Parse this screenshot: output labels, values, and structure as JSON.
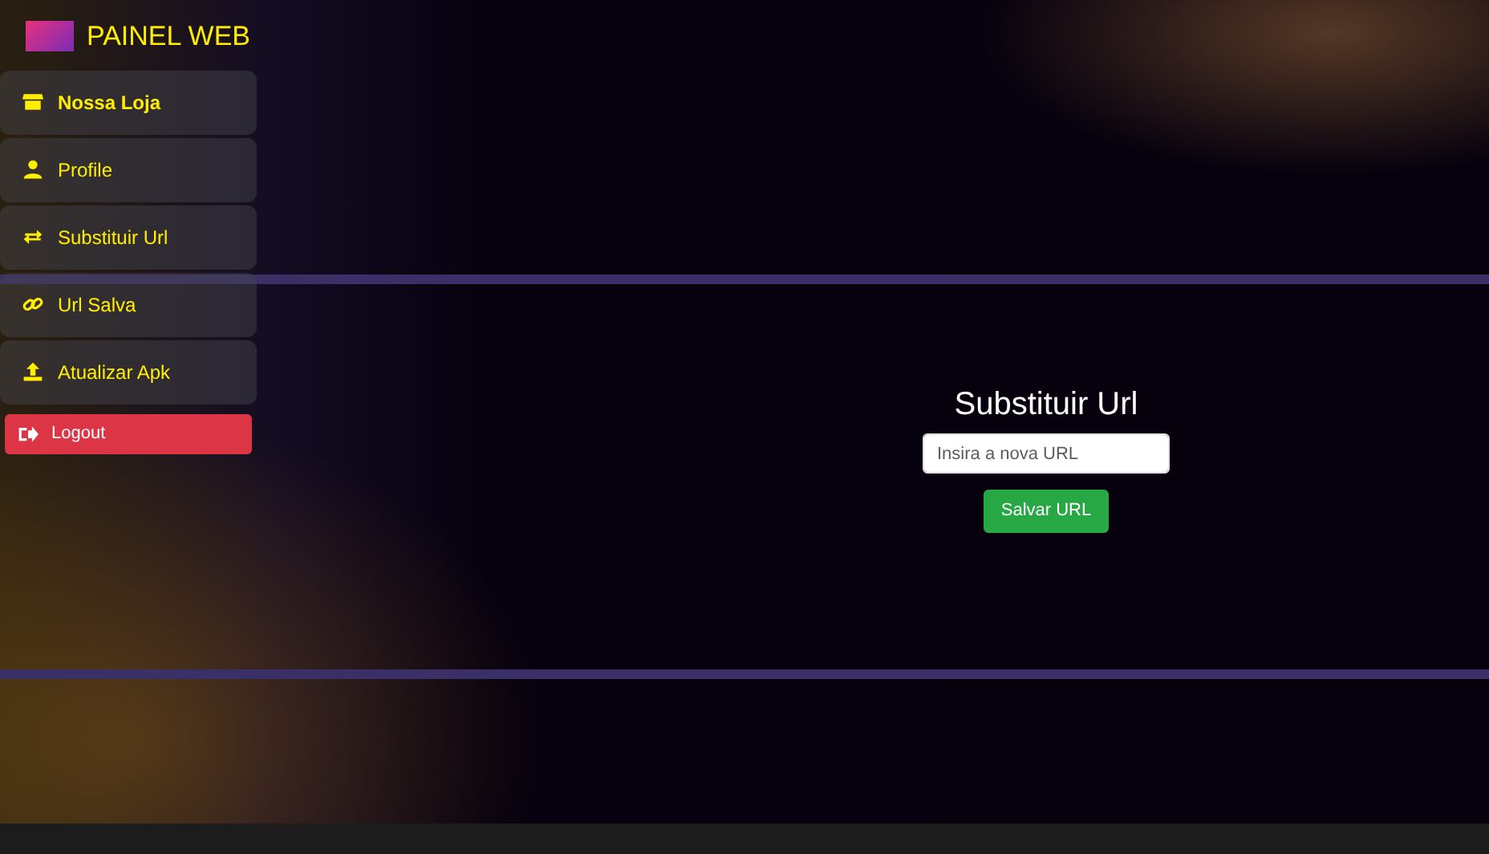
{
  "brand": {
    "title": "PAINEL WEB"
  },
  "sidebar": {
    "items": [
      {
        "kind": "link",
        "label": "Nossa Loja",
        "selected": true
      },
      {
        "kind": "link",
        "label": "Profile",
        "selected": false
      },
      {
        "kind": "link",
        "label": "Substituir Url",
        "selected": false
      },
      {
        "kind": "link",
        "label": "Url Salva",
        "selected": false
      },
      {
        "kind": "link",
        "label": "Atualizar Apk",
        "selected": false
      },
      {
        "kind": "logout",
        "label": "Logout",
        "selected": false
      }
    ]
  },
  "form": {
    "title": "Substituir Url",
    "placeholder": "Insira a nova URL",
    "button": "Salvar URL"
  }
}
